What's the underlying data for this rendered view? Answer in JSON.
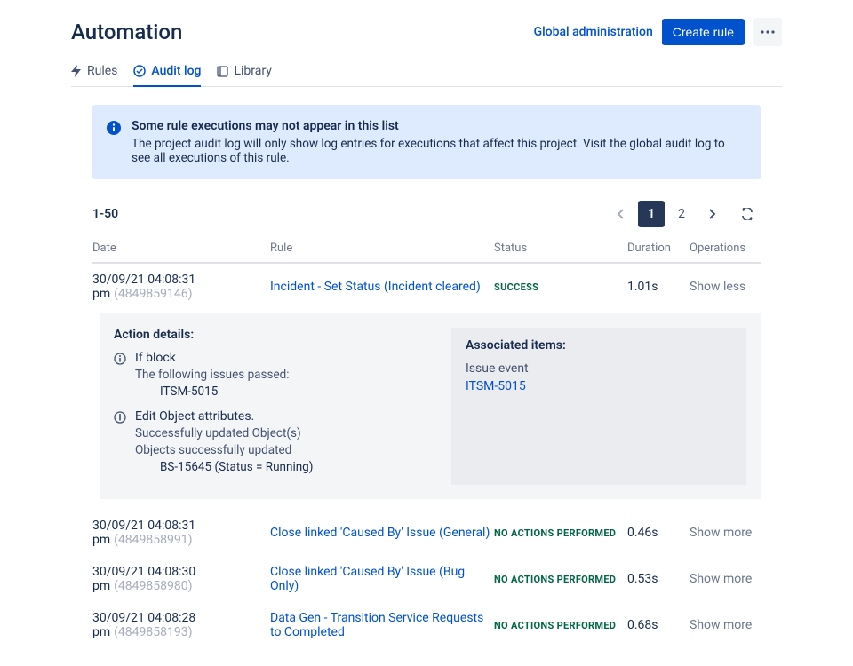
{
  "header": {
    "title": "Automation",
    "global_admin": "Global administration",
    "create_rule": "Create rule"
  },
  "tabs": {
    "rules": "Rules",
    "audit_log": "Audit log",
    "library": "Library"
  },
  "banner": {
    "title": "Some rule executions may not appear in this list",
    "text": "The project audit log will only show log entries for executions that affect this project. Visit the global audit log to see all executions of this rule."
  },
  "range": "1-50",
  "pager": {
    "p1": "1",
    "p2": "2"
  },
  "columns": {
    "date": "Date",
    "rule": "Rule",
    "status": "Status",
    "duration": "Duration",
    "operations": "Operations"
  },
  "rows": [
    {
      "date": "30/09/21 04:08:31 pm",
      "id": "(4849859146)",
      "rule": "Incident - Set Status (Incident cleared)",
      "status": "SUCCESS",
      "duration": "1.01s",
      "op": "Show less"
    },
    {
      "date": "30/09/21 04:08:31 pm",
      "id": "(4849858991)",
      "rule": "Close linked 'Caused By' Issue (General)",
      "status": "NO ACTIONS PERFORMED",
      "duration": "0.46s",
      "op": "Show more"
    },
    {
      "date": "30/09/21 04:08:30 pm",
      "id": "(4849858980)",
      "rule": "Close linked 'Caused By' Issue (Bug Only)",
      "status": "NO ACTIONS PERFORMED",
      "duration": "0.53s",
      "op": "Show more"
    },
    {
      "date": "30/09/21 04:08:28 pm",
      "id": "(4849858193)",
      "rule": "Data Gen - Transition Service Requests to Completed",
      "status": "NO ACTIONS PERFORMED",
      "duration": "0.68s",
      "op": "Show more"
    }
  ],
  "details": {
    "title": "Action details:",
    "if_block": "If block",
    "if_passed": "The following issues passed:",
    "if_issue": "ITSM-5015",
    "edit_title": "Edit Object attributes.",
    "edit_success": "Successfully updated Object(s)",
    "edit_objects": "Objects successfully updated",
    "edit_obj_val": "BS-15645 (Status = Running)",
    "assoc_title": "Associated items:",
    "assoc_label": "Issue event",
    "assoc_link": "ITSM-5015"
  }
}
